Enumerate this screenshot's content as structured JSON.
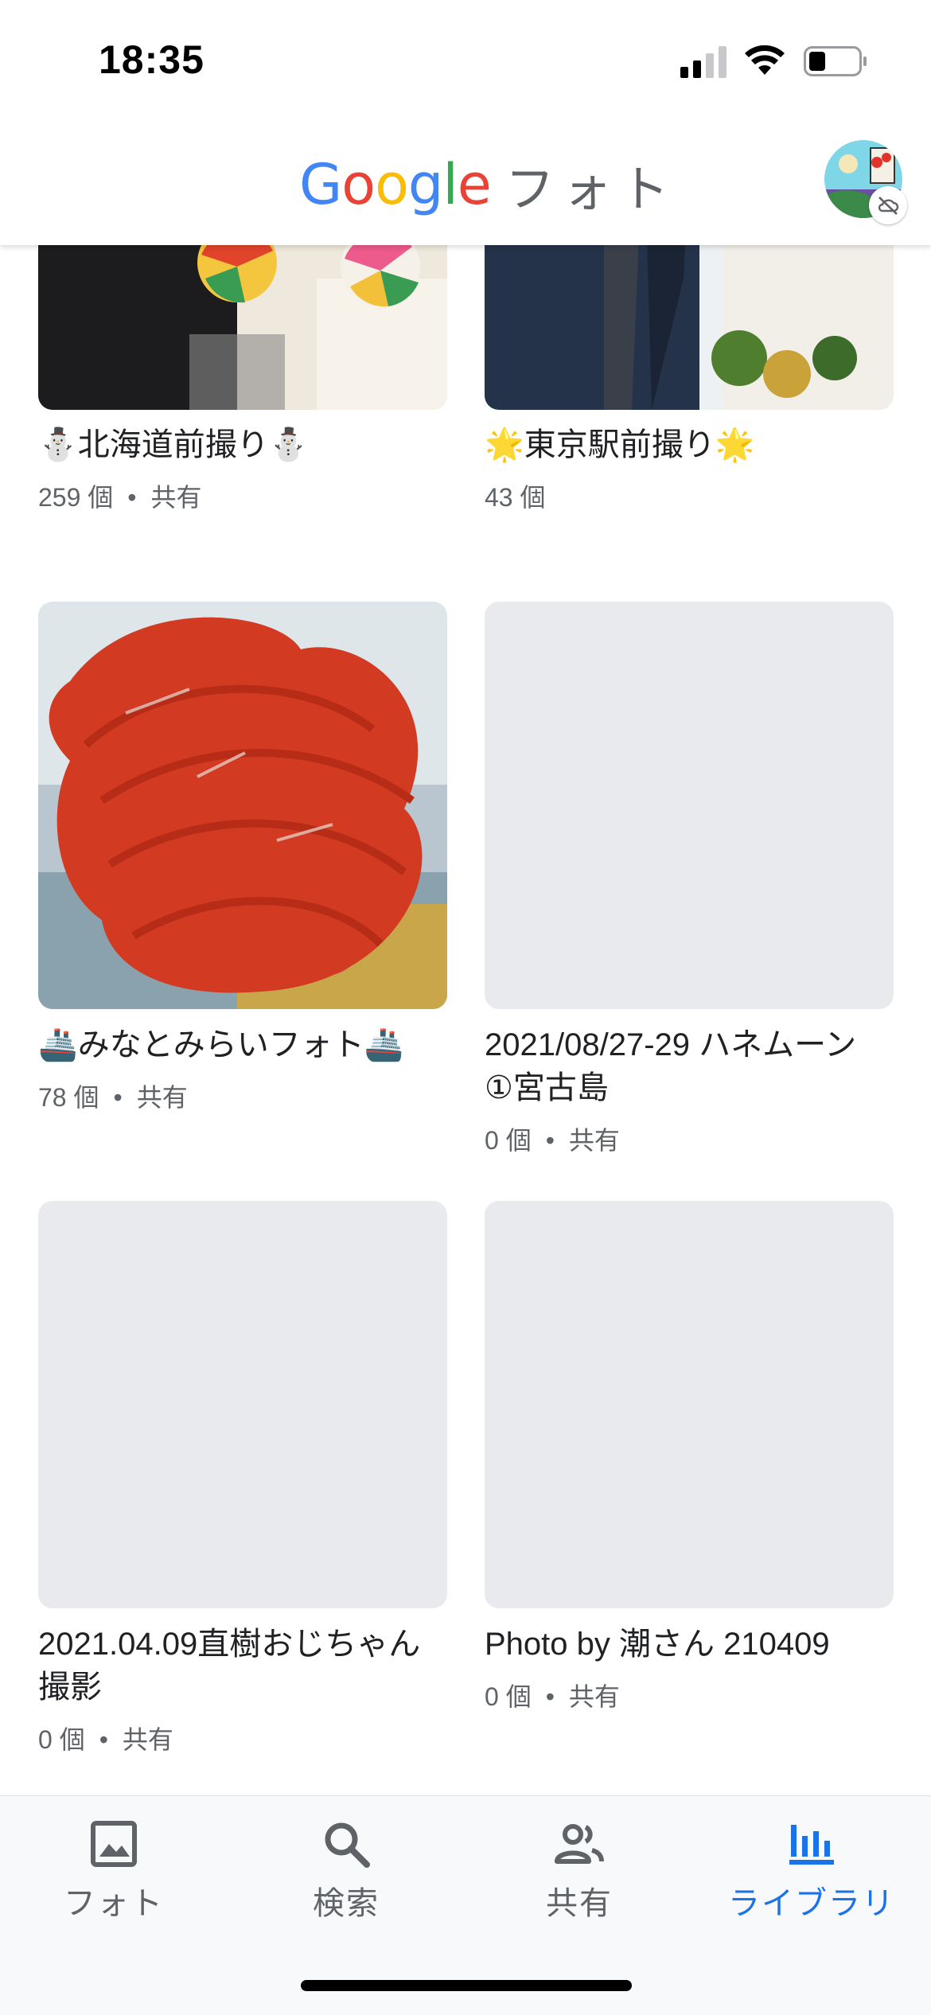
{
  "status_bar": {
    "time": "18:35"
  },
  "header": {
    "brand_letters": [
      "G",
      "o",
      "o",
      "g",
      "l",
      "e"
    ],
    "title": "フォト"
  },
  "albums": [
    {
      "title": "⛄北海道前撮り⛄",
      "count": "259 個",
      "shared": "共有"
    },
    {
      "title": "🌟東京駅前撮り🌟",
      "count": "43 個",
      "shared": ""
    },
    {
      "title": "🚢みなとみらいフォト🚢",
      "count": "78 個",
      "shared": "共有"
    },
    {
      "title": "2021/08/27-29 ハネムーン①宮古島",
      "count": "0 個",
      "shared": "共有"
    },
    {
      "title": "2021.04.09直樹おじちゃん撮影",
      "count": "0 個",
      "shared": "共有"
    },
    {
      "title": "Photo by 潮さん 210409",
      "count": "0 個",
      "shared": "共有"
    }
  ],
  "nav": [
    {
      "label": "フォト",
      "icon": "photo-icon",
      "active": false
    },
    {
      "label": "検索",
      "icon": "search-icon",
      "active": false
    },
    {
      "label": "共有",
      "icon": "people-icon",
      "active": false
    },
    {
      "label": "ライブラリ",
      "icon": "library-icon",
      "active": true
    }
  ],
  "colors": {
    "accent": "#1a73e8",
    "placeholder": "#e8eaed",
    "scribble": "#d23a22"
  }
}
